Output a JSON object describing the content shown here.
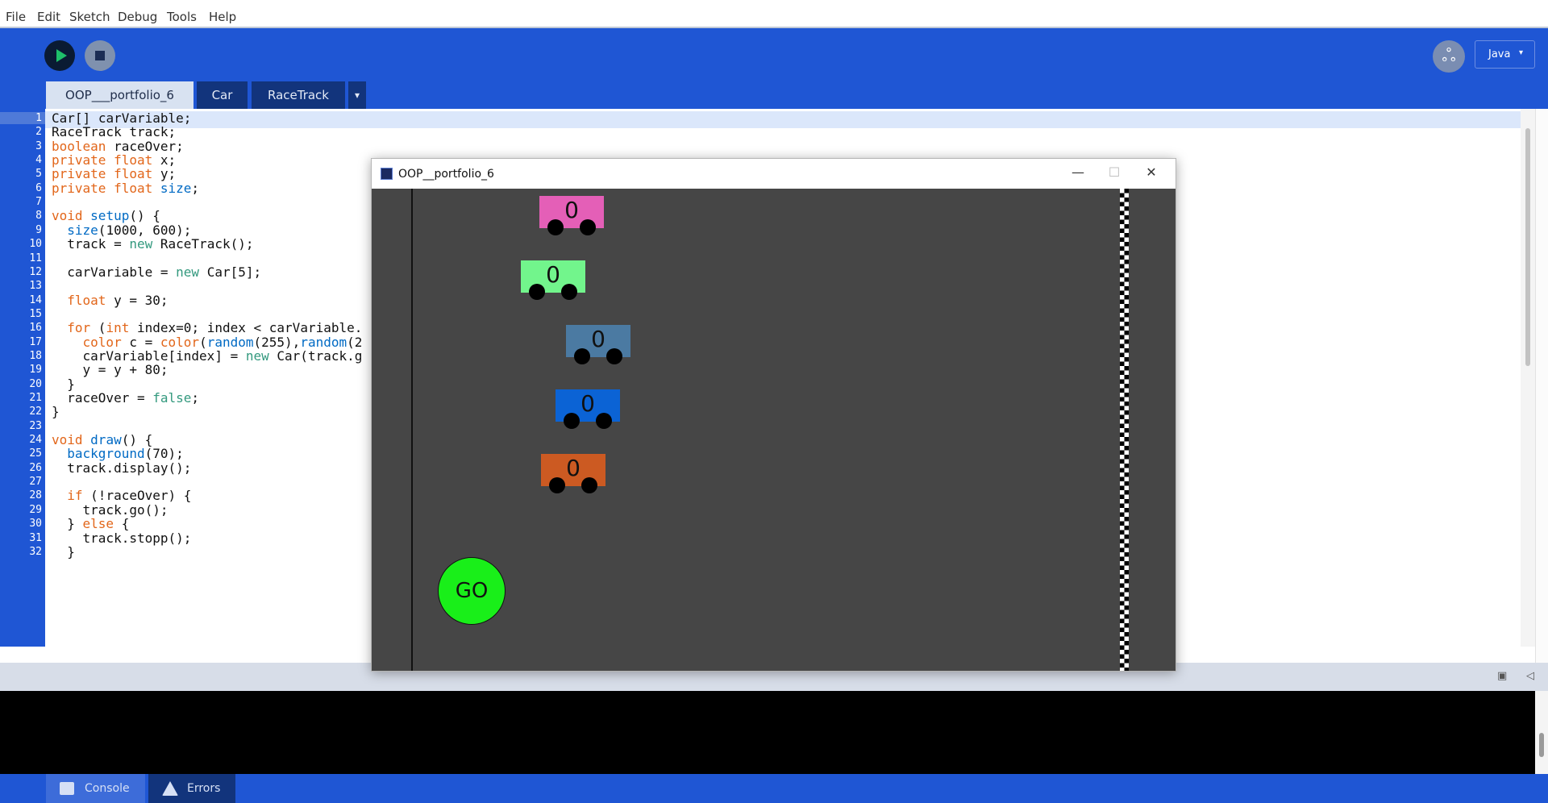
{
  "menu": [
    "File",
    "Edit",
    "Sketch",
    "Debug",
    "Tools",
    "Help"
  ],
  "toolbar": {
    "run_icon": "play-icon",
    "stop_icon": "stop-icon",
    "debug_icon": "butterfly-icon",
    "mode": "Java",
    "mode_arrow": "▾"
  },
  "tabs": [
    "OOP___portfolio_6",
    "Car",
    "RaceTrack"
  ],
  "tab_menu": "▾",
  "editor": {
    "current_line": 1,
    "lines": [
      "Car[] carVariable;",
      "RaceTrack track;",
      "boolean raceOver;",
      "private float x;",
      "private float y;",
      "private float size;",
      "",
      "void setup() {",
      "  size(1000, 600);",
      "  track = new RaceTrack();",
      "",
      "  carVariable = new Car[5];",
      "",
      "  float y = 30;",
      "",
      "  for (int index=0; index < carVariable.",
      "    color c = color(random(255),random(2",
      "    carVariable[index] = new Car(track.g",
      "    y = y + 80;",
      "  }",
      "  raceOver = false;",
      "}",
      "",
      "void draw() {",
      "  background(70);",
      "  track.display();",
      "",
      "  if (!raceOver) {",
      "    track.go();",
      "  } else {",
      "    track.stopp();",
      "  }"
    ]
  },
  "sketch": {
    "title": "OOP__portfolio_6",
    "minimize": "—",
    "maximize": "☐",
    "close": "✕",
    "background": "#464646",
    "cars": [
      {
        "color": "#e45fb7",
        "label": "0"
      },
      {
        "color": "#72f58c",
        "label": "0"
      },
      {
        "color": "#4b7aa2",
        "label": "0"
      },
      {
        "color": "#0b63d5",
        "label": "0"
      },
      {
        "color": "#cc5a22",
        "label": "0"
      }
    ],
    "go_button": "GO",
    "go_color": "#19ef19"
  },
  "console": {
    "tabs": [
      "Console",
      "Errors"
    ],
    "copy_icon": "clipboard-icon",
    "collapse_icon": "◁"
  }
}
